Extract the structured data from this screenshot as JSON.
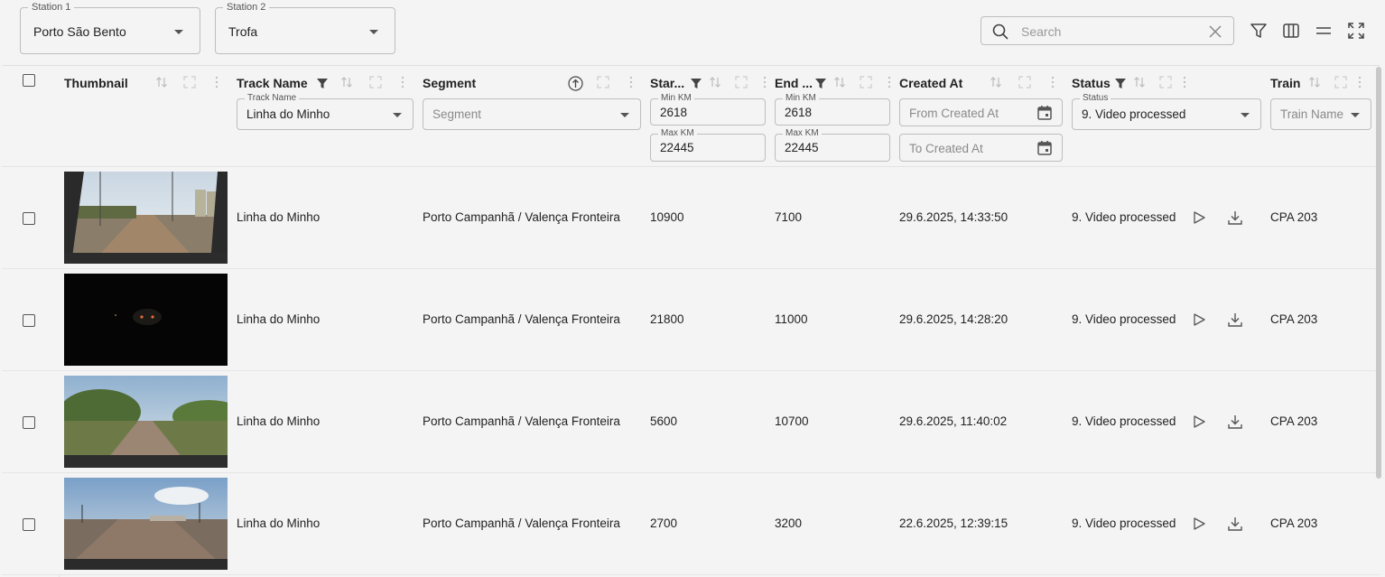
{
  "filters": {
    "station1": {
      "label": "Station 1",
      "value": "Porto São Bento"
    },
    "station2": {
      "label": "Station 2",
      "value": "Trofa"
    },
    "search_placeholder": "Search"
  },
  "toolbar_icons": [
    "filter-icon",
    "columns-icon",
    "density-icon",
    "fullscreen-icon"
  ],
  "columns": {
    "thumbnail": "Thumbnail",
    "track_name": "Track Name",
    "segment": "Segment",
    "start": "Star...",
    "end": "End ...",
    "created_at": "Created At",
    "status": "Status",
    "train": "Train"
  },
  "column_filters": {
    "track_name": {
      "label": "Track Name",
      "value": "Linha do Minho"
    },
    "segment": {
      "placeholder": "Segment"
    },
    "start": {
      "min_label": "Min KM",
      "min": "2618",
      "max_label": "Max KM",
      "max": "22445"
    },
    "end": {
      "min_label": "Min KM",
      "min": "2618",
      "max_label": "Max KM",
      "max": "22445"
    },
    "created_from_placeholder": "From Created At",
    "created_to_placeholder": "To Created At",
    "status": {
      "label": "Status",
      "value": "9. Video processed"
    },
    "train_placeholder": "Train Name"
  },
  "rows": [
    {
      "track": "Linha do Minho",
      "segment": "Porto Campanhã / Valença Fronteira",
      "start": "10900",
      "end": "7100",
      "created": "29.6.2025, 14:33:50",
      "status": "9. Video processed",
      "train": "CPA 203",
      "thumb": "daylight-track"
    },
    {
      "track": "Linha do Minho",
      "segment": "Porto Campanhã / Valença Fronteira",
      "start": "21800",
      "end": "11000",
      "created": "29.6.2025, 14:28:20",
      "status": "9. Video processed",
      "train": "CPA 203",
      "thumb": "tunnel"
    },
    {
      "track": "Linha do Minho",
      "segment": "Porto Campanhã / Valença Fronteira",
      "start": "5600",
      "end": "10700",
      "created": "29.6.2025, 11:40:02",
      "status": "9. Video processed",
      "train": "CPA 203",
      "thumb": "countryside-track"
    },
    {
      "track": "Linha do Minho",
      "segment": "Porto Campanhã / Valença Fronteira",
      "start": "2700",
      "end": "3200",
      "created": "22.6.2025, 12:39:15",
      "status": "9. Video processed",
      "train": "CPA 203",
      "thumb": "station-yard"
    }
  ]
}
